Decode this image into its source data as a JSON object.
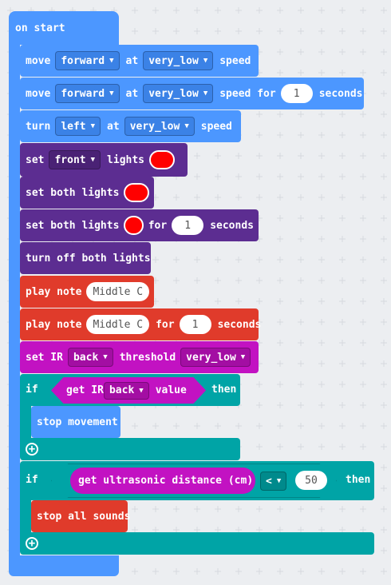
{
  "on_start": "on start",
  "move1": {
    "label": "move",
    "dir": "forward",
    "at": "at",
    "speed_val": "very_low",
    "speed": "speed"
  },
  "move2": {
    "label": "move",
    "dir": "forward",
    "at": "at",
    "speed_val": "very_low",
    "speed": "speed for",
    "num": "1",
    "unit": "seconds"
  },
  "turn": {
    "label": "turn",
    "dir": "left",
    "at": "at",
    "speed_val": "very_low",
    "speed": "speed"
  },
  "set_front": {
    "label": "set",
    "which": "front",
    "lights": "lights",
    "color": "#ff0000"
  },
  "set_both": {
    "label": "set both lights",
    "color": "#ff0000"
  },
  "set_both_for": {
    "label": "set both lights",
    "for": "for",
    "num": "1",
    "unit": "seconds",
    "color": "#ff0000"
  },
  "turn_off": {
    "label": "turn off both lights"
  },
  "play1": {
    "label": "play note",
    "note": "Middle C"
  },
  "play2": {
    "label": "play note",
    "note": "Middle C",
    "for": "for",
    "num": "1",
    "unit": "seconds"
  },
  "set_ir": {
    "label": "set IR",
    "which": "back",
    "threshold": "threshold",
    "val": "very_low"
  },
  "if1": {
    "if": "if",
    "get": "get IR",
    "which": "back",
    "value": "value",
    "then": "then",
    "body": "stop movement"
  },
  "if2": {
    "if": "if",
    "get": "get ultrasonic distance (cm)",
    "op": "<",
    "num": "50",
    "then": "then",
    "body": "stop all sounds"
  }
}
